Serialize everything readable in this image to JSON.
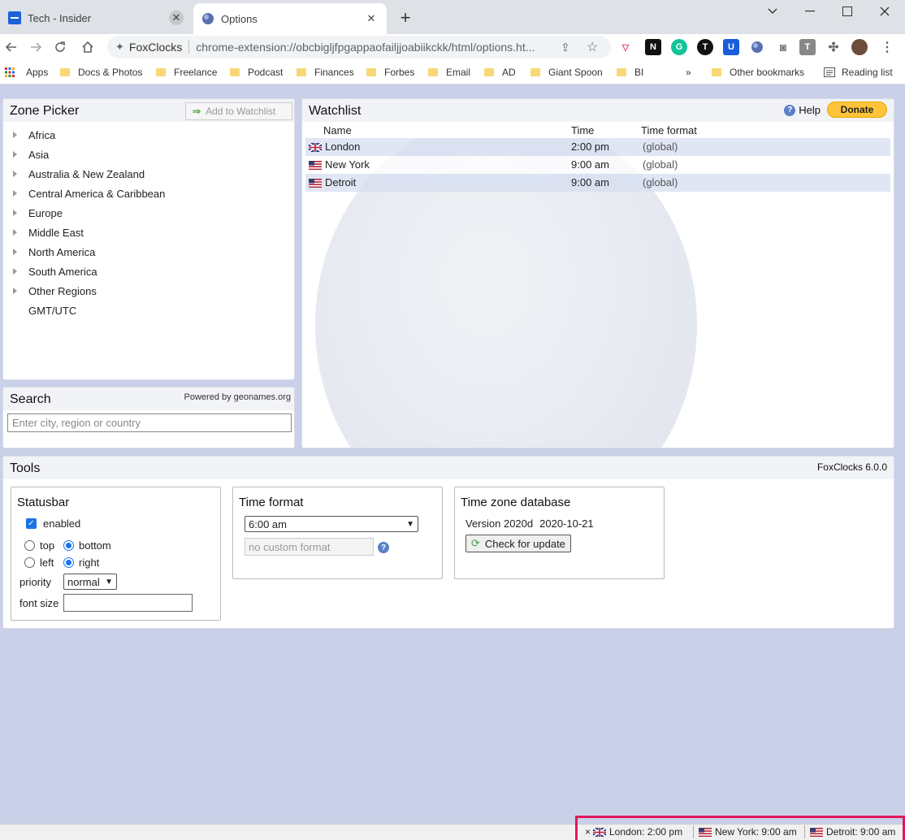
{
  "browser": {
    "tabs": [
      {
        "title": "Tech - Insider",
        "active": false
      },
      {
        "title": "Options",
        "active": true
      }
    ],
    "omnibox": {
      "site": "FoxClocks",
      "url": "chrome-extension://obcbigljfpgappaofailjjoabiikckk/html/options.ht..."
    },
    "bookmarks": [
      "Apps",
      "Docs & Photos",
      "Freelance",
      "Podcast",
      "Finances",
      "Forbes",
      "Email",
      "AD",
      "Giant Spoon",
      "BI"
    ],
    "overflow_label": "»",
    "other_bookmarks": "Other bookmarks",
    "reading_list": "Reading list",
    "extensions": [
      "pocket-icon",
      "notion-icon",
      "grammarly-icon",
      "t-icon",
      "bitwarden-icon",
      "foxclocks-icon",
      "camera-icon",
      "t-gray-icon",
      "puzzle-icon",
      "avatar"
    ]
  },
  "zone_picker": {
    "title": "Zone Picker",
    "add_button": "Add to Watchlist",
    "regions": [
      "Africa",
      "Asia",
      "Australia & New Zealand",
      "Central America & Caribbean",
      "Europe",
      "Middle East",
      "North America",
      "South America",
      "Other Regions",
      "GMT/UTC"
    ]
  },
  "search": {
    "title": "Search",
    "powered_by": "Powered by geonames.org",
    "placeholder": "Enter city, region or country"
  },
  "watchlist": {
    "title": "Watchlist",
    "help": "Help",
    "donate": "Donate",
    "columns": {
      "name": "Name",
      "time": "Time",
      "format": "Time format"
    },
    "rows": [
      {
        "flag": "uk",
        "name": "London",
        "time": "2:00 pm",
        "format": "(global)"
      },
      {
        "flag": "us",
        "name": "New York",
        "time": "9:00 am",
        "format": "(global)"
      },
      {
        "flag": "us",
        "name": "Detroit",
        "time": "9:00 am",
        "format": "(global)"
      }
    ]
  },
  "tools": {
    "title": "Tools",
    "version": "FoxClocks 6.0.0",
    "statusbar": {
      "title": "Statusbar",
      "enabled_label": "enabled",
      "enabled": true,
      "top_label": "top",
      "bottom_label": "bottom",
      "left_label": "left",
      "right_label": "right",
      "vertical": "bottom",
      "horizontal": "right",
      "priority_label": "priority",
      "priority_value": "normal",
      "font_size_label": "font size",
      "font_size_value": ""
    },
    "time_format": {
      "title": "Time format",
      "selected": "6:00 am",
      "custom_placeholder": "no custom format"
    },
    "tz_database": {
      "title": "Time zone database",
      "version_label": "Version 2020d",
      "date": "2020-10-21",
      "check_button": "Check for update"
    }
  },
  "status_bar": {
    "close": "×",
    "items": [
      {
        "flag": "uk",
        "text": "London: 2:00 pm"
      },
      {
        "flag": "us",
        "text": "New York: 9:00 am"
      },
      {
        "flag": "us",
        "text": "Detroit: 9:00 am"
      }
    ]
  },
  "colors": {
    "page_bg": "#c9d0e8",
    "highlight_border": "#e0195a",
    "donate_yellow": "#ffc439",
    "checkbox_blue": "#1a73e8"
  }
}
